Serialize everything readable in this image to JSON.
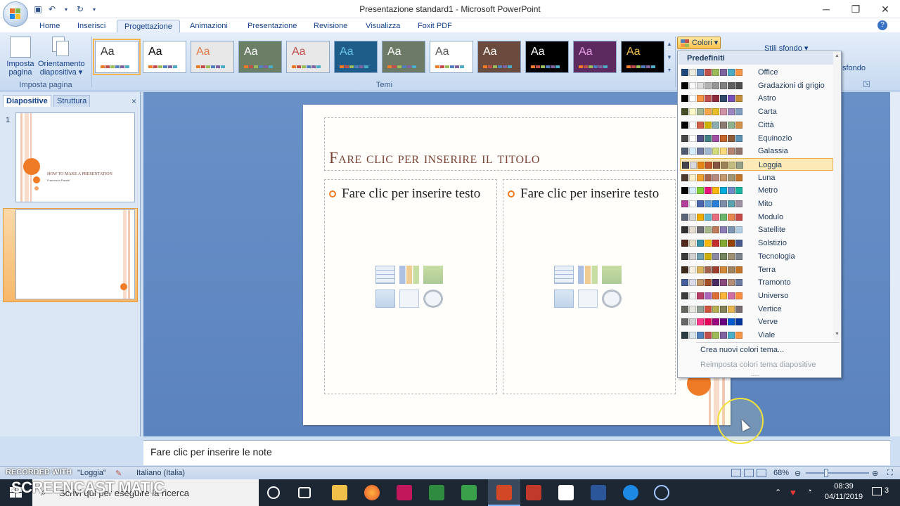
{
  "window": {
    "title": "Presentazione standard1 - Microsoft PowerPoint",
    "controls": [
      "─",
      "❐",
      "✕"
    ]
  },
  "tabs": [
    {
      "label": "Home"
    },
    {
      "label": "Inserisci"
    },
    {
      "label": "Progettazione",
      "active": true
    },
    {
      "label": "Animazioni"
    },
    {
      "label": "Presentazione"
    },
    {
      "label": "Revisione"
    },
    {
      "label": "Visualizza"
    },
    {
      "label": "Foxit PDF"
    }
  ],
  "ribbon": {
    "imposta_pagina": "Imposta pagina",
    "orientamento": "Orientamento diapositiva",
    "group_imposta": "Imposta pagina",
    "group_temi": "Temi",
    "theme_sample": "Aa",
    "colori": "Colori",
    "stili_sfondo": "Stili sfondo",
    "sfondo": "sfondo"
  },
  "themes": [
    {
      "bg": "#ffffff",
      "fg": "#333333",
      "selected": true
    },
    {
      "bg": "#ffffff",
      "fg": "#000000"
    },
    {
      "bg": "#e8e8e8",
      "fg": "#e07b47"
    },
    {
      "bg": "#6b7e66",
      "fg": "#ffffff"
    },
    {
      "bg": "#e8e8e8",
      "fg": "#c0504d"
    },
    {
      "bg": "#1e5c8a",
      "fg": "#6cc4e6"
    },
    {
      "bg": "#6d7a66",
      "fg": "#ffffff"
    },
    {
      "bg": "#ffffff",
      "fg": "#555555"
    },
    {
      "bg": "#6b4b3e",
      "fg": "#ffffff"
    },
    {
      "bg": "#000000",
      "fg": "#ffffff"
    },
    {
      "bg": "#5c2a5e",
      "fg": "#e6a0e6"
    },
    {
      "bg": "#000000",
      "fg": "#f2c04b"
    }
  ],
  "left_panel": {
    "tab_diapositive": "Diapositive",
    "tab_struttura": "Struttura",
    "close": "×",
    "slide1_num": "1",
    "slide2_num": "2",
    "slide1_title": "How to make a presentation",
    "slide1_subtitle": "Francesca Pacetti"
  },
  "slide": {
    "title_placeholder": "Fare clic per inserire il titolo",
    "left_text": "Fare clic per inserire testo",
    "right_text": "Fare clic per inserire testo"
  },
  "color_menu": {
    "header": "Predefiniti",
    "schemes": [
      {
        "name": "Office",
        "colors": [
          "#1f497d",
          "#eeece1",
          "#4f81bd",
          "#c0504d",
          "#9bbb59",
          "#8064a2",
          "#4bacc6",
          "#f79646"
        ]
      },
      {
        "name": "Gradazioni di grigio",
        "colors": [
          "#000000",
          "#f8f8f8",
          "#dddddd",
          "#b2b2b2",
          "#969696",
          "#808080",
          "#5f5f5f",
          "#4d4d4d"
        ]
      },
      {
        "name": "Astro",
        "colors": [
          "#000000",
          "#ffffff",
          "#f79646",
          "#c0504d",
          "#8c2b3a",
          "#30496a",
          "#774fb9",
          "#c38b3a"
        ]
      },
      {
        "name": "Carta",
        "colors": [
          "#444d26",
          "#fefac9",
          "#a5b592",
          "#f3a447",
          "#e7bc29",
          "#d092a7",
          "#9c85c0",
          "#809ec2"
        ]
      },
      {
        "name": "Città",
        "colors": [
          "#000000",
          "#ffffff",
          "#d16349",
          "#ccb400",
          "#8cadae",
          "#8c7b70",
          "#8fb08c",
          "#d19049"
        ]
      },
      {
        "name": "Equinozio",
        "colors": [
          "#464646",
          "#ffffff",
          "#53548a",
          "#438086",
          "#a04da3",
          "#c4652d",
          "#8b5d3d",
          "#5c92b5"
        ]
      },
      {
        "name": "Galassia",
        "colors": [
          "#4e5b6f",
          "#d6ecff",
          "#727ca3",
          "#9fb8cd",
          "#d2da7a",
          "#fada7a",
          "#b88472",
          "#8e736a"
        ]
      },
      {
        "name": "Loggia",
        "colors": [
          "#454551",
          "#d8d9dc",
          "#e48312",
          "#bd582c",
          "#865640",
          "#9b8357",
          "#c2bc80",
          "#94a088"
        ],
        "selected": true
      },
      {
        "name": "Luna",
        "colors": [
          "#4e3b30",
          "#fbeec9",
          "#f0a22e",
          "#a5644e",
          "#b58b80",
          "#c3986d",
          "#a19574",
          "#c17529"
        ]
      },
      {
        "name": "Metro",
        "colors": [
          "#000000",
          "#d6ecff",
          "#7fd13b",
          "#ea157a",
          "#feb80a",
          "#00addc",
          "#738ac8",
          "#1ab39f"
        ]
      },
      {
        "name": "Mito",
        "colors": [
          "#b13f9a",
          "#ffffff",
          "#4a66ac",
          "#629dd1",
          "#297fd5",
          "#7f8fa9",
          "#5aa2ae",
          "#9d90a0"
        ]
      },
      {
        "name": "Modulo",
        "colors": [
          "#5a6378",
          "#d4d4d4",
          "#f0ad00",
          "#60b5cc",
          "#e66c7d",
          "#6bb76d",
          "#e88651",
          "#c64847"
        ]
      },
      {
        "name": "Satellite",
        "colors": [
          "#323232",
          "#e3ded1",
          "#6f6f74",
          "#a7b789",
          "#bd7b59",
          "#8b7eb6",
          "#7c96b3",
          "#b1cde3"
        ]
      },
      {
        "name": "Solstizio",
        "colors": [
          "#4f271c",
          "#e7dec9",
          "#3891a7",
          "#feb80a",
          "#c32d2e",
          "#84aa33",
          "#964305",
          "#475a8d"
        ]
      },
      {
        "name": "Tecnologia",
        "colors": [
          "#3b3b3b",
          "#d4d2d0",
          "#6ea0b0",
          "#ccaf0a",
          "#8d89a4",
          "#748560",
          "#9e9273",
          "#7e848d"
        ]
      },
      {
        "name": "Terra",
        "colors": [
          "#3b2a1e",
          "#f5f0e1",
          "#d8b25c",
          "#a5644e",
          "#9c3e2e",
          "#d18a3c",
          "#a18460",
          "#c17529"
        ]
      },
      {
        "name": "Tramonto",
        "colors": [
          "#465e9c",
          "#dbdded",
          "#c3986d",
          "#a54e27",
          "#4a2a63",
          "#8b4b7e",
          "#b48e78",
          "#6b7aa0"
        ]
      },
      {
        "name": "Universo",
        "colors": [
          "#3d3d3d",
          "#f2f2f2",
          "#b83d68",
          "#ac66bb",
          "#de6c36",
          "#f9b639",
          "#cf6da4",
          "#fa8d3d"
        ]
      },
      {
        "name": "Vertice",
        "colors": [
          "#686660",
          "#e8e7e1",
          "#93a299",
          "#cf543f",
          "#b5ae53",
          "#848058",
          "#e8b54d",
          "#786c71"
        ]
      },
      {
        "name": "Verve",
        "colors": [
          "#666666",
          "#d2d2d2",
          "#ff388c",
          "#e40059",
          "#9c007f",
          "#68007f",
          "#005bd3",
          "#00349e"
        ]
      },
      {
        "name": "Viale",
        "colors": [
          "#2c3c43",
          "#dbe6eb",
          "#4f81bd",
          "#c0504d",
          "#9bbb59",
          "#8064a2",
          "#4bacc6",
          "#f79646"
        ]
      }
    ],
    "create_new": "Crea nuovi colori tema...",
    "reset": "Reimposta colori tema diapositive",
    "grip": "....."
  },
  "notes": {
    "placeholder": "Fare clic per inserire le note"
  },
  "status": {
    "theme": "\"Loggia\"",
    "language": "Italiano (Italia)",
    "zoom": "68%"
  },
  "watermark": {
    "recorded": "RECORDED WITH",
    "brand": "SCREENCAST MATIC"
  },
  "taskbar": {
    "search_placeholder": "Scrivi qui per eseguire la ricerca",
    "time": "08:39",
    "date": "04/11/2019",
    "notifications": "3"
  },
  "colors": {
    "accent_orange": "#f07b27",
    "ribbon_blue": "#d2e1f4",
    "slide_bg_blue": "#5b83be"
  }
}
